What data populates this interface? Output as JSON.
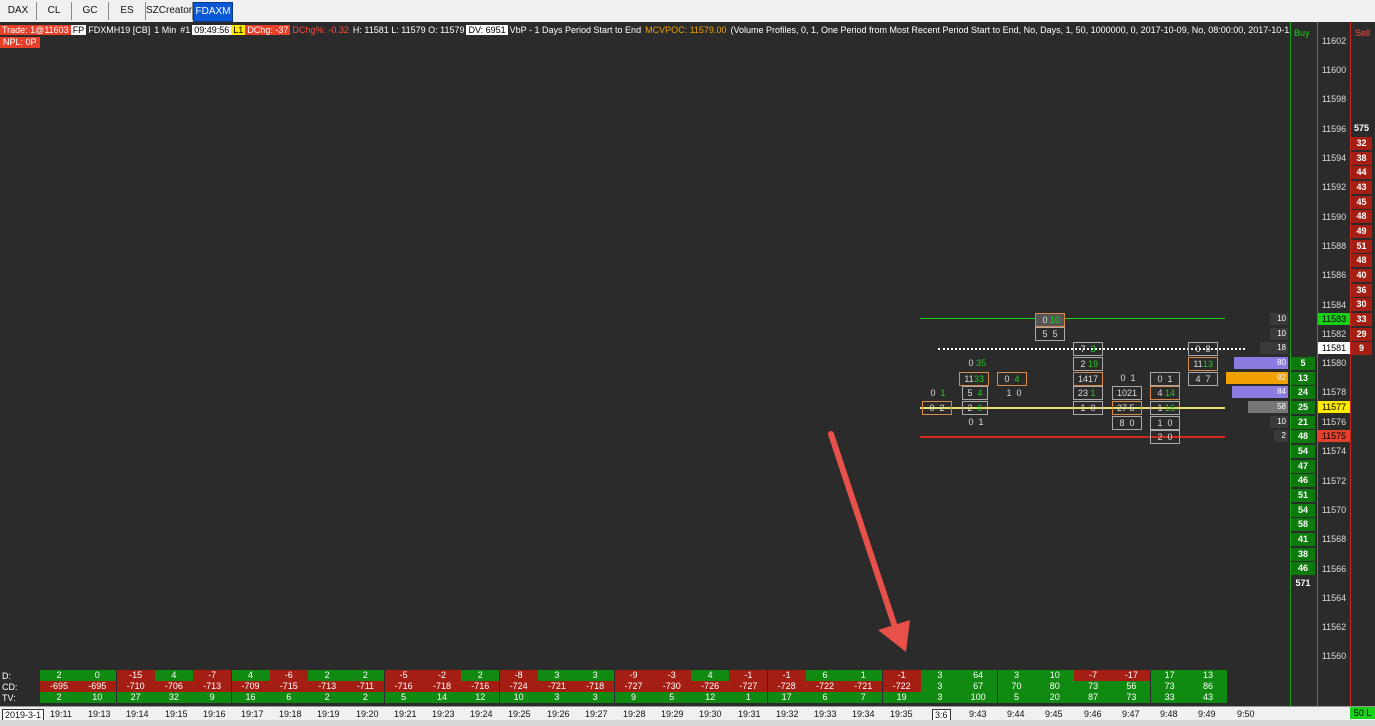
{
  "tabs": [
    {
      "label": "DAX"
    },
    {
      "label": "CL"
    },
    {
      "label": "GC"
    },
    {
      "label": "ES"
    },
    {
      "label": "SZCreator"
    },
    {
      "label": "FDAXM",
      "active": true
    }
  ],
  "info": {
    "trade": "Trade: 1@11603",
    "fp": "FP",
    "symbol": "FDXMH19 [CB]",
    "interval": "1 Min",
    "chart_num": "#1",
    "time": "09:49:56",
    "level": "L1",
    "dchg": "DChg: -37",
    "dchg_pct": "DChg%: -0.32",
    "hlo": "H: 11581 L: 11579 O: 11579",
    "dv": "DV: 6951",
    "vbp": "VbP - 1 Days Period Start to End",
    "mcvpoc": "MCVPOC: 11579.00",
    "study": "(Volume Profiles, 0, 1, One Period from Most Recent Period Start to End, No, Days, 1, 50, 1000000, 0, 2017-10-09, No, 08:00:00, 2017-10-12, 21:59:59, No, No",
    "npl": "NPL: 0P"
  },
  "buy_label": "Buy",
  "sell_label": "Sell",
  "prices": [
    "11602",
    "11600",
    "11598",
    "11596",
    "11594",
    "11592",
    "11590",
    "11588",
    "11586",
    "11584",
    "11583",
    "11582",
    "11581",
    "11580",
    "11579",
    "11578",
    "11577",
    "11576",
    "11575",
    "11574",
    "11572",
    "11570",
    "11568",
    "11566",
    "11564",
    "11562",
    "11560"
  ],
  "sell_total": "575",
  "sell_values": [
    "32",
    "38",
    "44",
    "43",
    "45",
    "48",
    "49",
    "51",
    "48",
    "40",
    "36",
    "30",
    "33",
    "29",
    "9"
  ],
  "buy_values": [
    "5",
    "13",
    "24",
    "25",
    "21",
    "48",
    "54",
    "47",
    "46",
    "51",
    "54",
    "58",
    "41",
    "38",
    "46"
  ],
  "buy_total": "571",
  "vp_values": [
    "10",
    "10",
    "18",
    "80",
    "92",
    "84",
    "58",
    "10",
    "2"
  ],
  "footprint": [
    {
      "l": "0",
      "r": "1"
    },
    {
      "l": "0",
      "r": "2"
    },
    {
      "l": "0",
      "r": "35"
    },
    {
      "l": "11",
      "r": "33"
    },
    {
      "l": "5",
      "r": "4"
    },
    {
      "l": "2",
      "r": "0"
    },
    {
      "l": "0",
      "r": "1"
    },
    {
      "l": "0",
      "r": "4"
    },
    {
      "l": "1",
      "r": "0"
    },
    {
      "l": "0",
      "r": "10"
    },
    {
      "l": "5",
      "r": "5"
    },
    {
      "l": "7",
      "r": "3"
    },
    {
      "l": "2",
      "r": "19"
    },
    {
      "l": "14",
      "r": "17"
    },
    {
      "l": "23",
      "r": "1"
    },
    {
      "l": "1",
      "r": "0"
    },
    {
      "l": "0",
      "r": "1"
    },
    {
      "l": "10",
      "r": "21"
    },
    {
      "l": "27",
      "r": "5"
    },
    {
      "l": "8",
      "r": "0"
    },
    {
      "l": "0",
      "r": "1"
    },
    {
      "l": "4",
      "r": "14"
    },
    {
      "l": "1",
      "r": "16"
    },
    {
      "l": "1",
      "r": "0"
    },
    {
      "l": "2",
      "r": "0"
    },
    {
      "l": "0",
      "r": "8"
    },
    {
      "l": "11",
      "r": "13"
    },
    {
      "l": "4",
      "r": "7"
    }
  ],
  "bottom": {
    "labels": [
      "D:",
      "CD:",
      "TV:"
    ],
    "d": [
      "2",
      "0",
      "-15",
      "4",
      "-7",
      "4",
      "-6",
      "2",
      "2",
      "-5",
      "-2",
      "2",
      "-8",
      "3",
      "3",
      "-9",
      "-3",
      "4",
      "-1",
      "-1",
      "6",
      "1",
      "-1",
      "3",
      "64",
      "3",
      "10",
      "-7",
      "-17",
      "17",
      "13"
    ],
    "cd": [
      "-695",
      "-695",
      "-710",
      "-706",
      "-713",
      "-709",
      "-715",
      "-713",
      "-711",
      "-716",
      "-718",
      "-716",
      "-724",
      "-721",
      "-718",
      "-727",
      "-730",
      "-726",
      "-727",
      "-728",
      "-722",
      "-721",
      "-722",
      "3",
      "67",
      "70",
      "80",
      "73",
      "56",
      "73",
      "86"
    ],
    "tv": [
      "2",
      "10",
      "27",
      "32",
      "9",
      "16",
      "6",
      "2",
      "2",
      "5",
      "14",
      "12",
      "10",
      "3",
      "3",
      "9",
      "5",
      "12",
      "1",
      "17",
      "6",
      "7",
      "19",
      "3",
      "100",
      "5",
      "20",
      "87",
      "73",
      "33",
      "43"
    ]
  },
  "times": [
    "2019-3-1",
    "19:11",
    "19:13",
    "19:14",
    "19:15",
    "19:16",
    "19:17",
    "19:18",
    "19:19",
    "19:20",
    "19:21",
    "19:23",
    "19:24",
    "19:25",
    "19:26",
    "19:27",
    "19:28",
    "19:29",
    "19:30",
    "19:31",
    "19:32",
    "19:33",
    "19:34",
    "19:35",
    "3:6",
    "9:43",
    "9:44",
    "9:45",
    "9:46",
    "9:47",
    "9:48",
    "9:49",
    "9:50"
  ],
  "corner": "50 L",
  "colors": {
    "green": "#1ad11a",
    "red": "#e6402b",
    "yellow": "#ffea00",
    "orange": "#d98a4a",
    "arrow": "#e8504a",
    "vp": "#8a7be0"
  }
}
